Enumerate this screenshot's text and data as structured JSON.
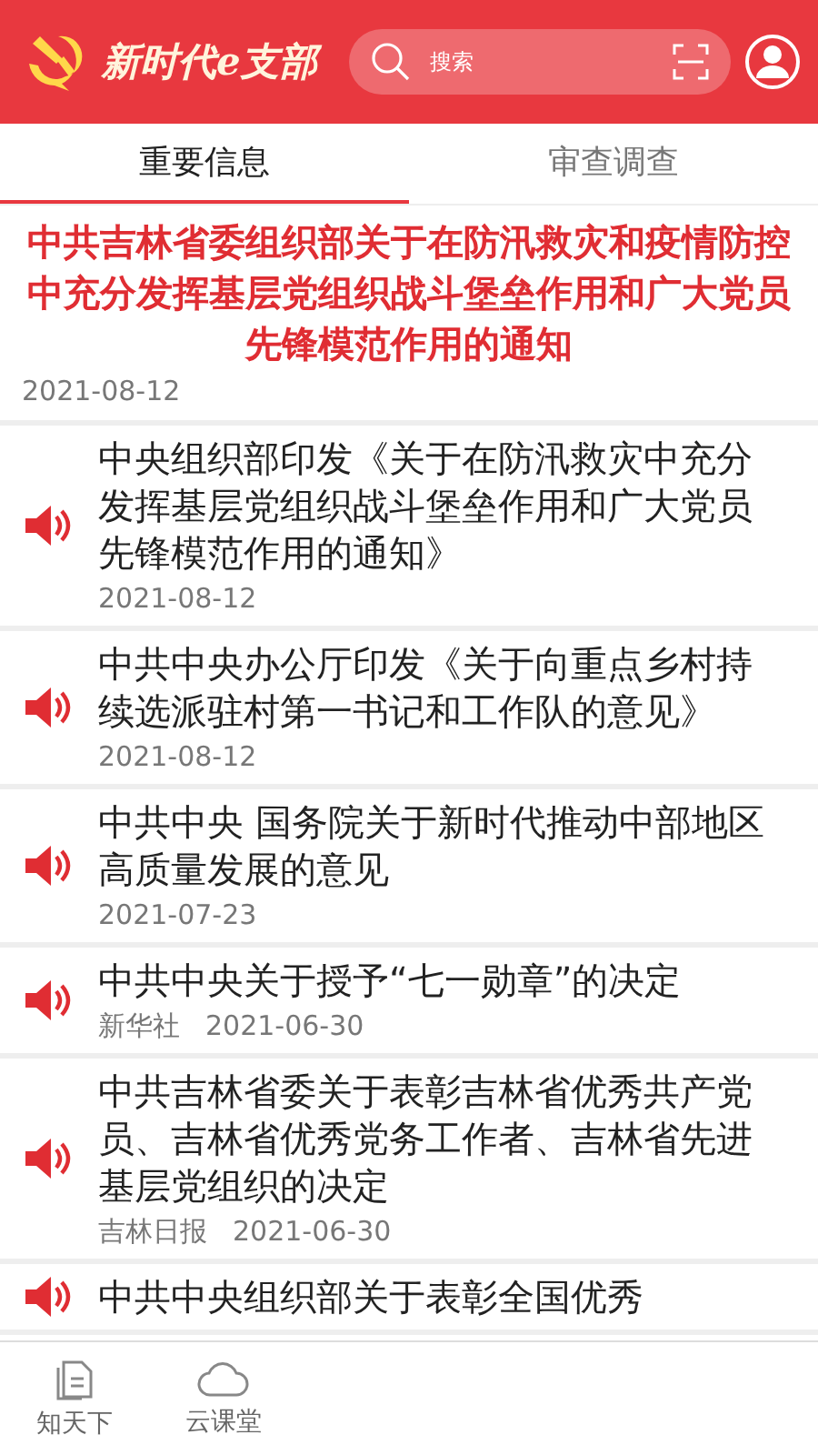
{
  "header": {
    "app_title": "新时代e支部",
    "search": {
      "placeholder": "搜索"
    }
  },
  "tabs": [
    {
      "label": "重要信息",
      "selected": true
    },
    {
      "label": "审查调查",
      "selected": false
    }
  ],
  "featured": {
    "title": "中共吉林省委组织部关于在防汛救灾和疫情防控中充分发挥基层党组织战斗堡垒作用和广大党员先锋模范作用的通知",
    "date": "2021-08-12"
  },
  "news": [
    {
      "title": "中央组织部印发《关于在防汛救灾中充分发挥基层党组织战斗堡垒作用和广大党员先锋模范作用的通知》",
      "date": "2021-08-12"
    },
    {
      "title": "中共中央办公厅印发《关于向重点乡村持续选派驻村第一书记和工作队的意见》",
      "date": "2021-08-12"
    },
    {
      "title": "中共中央 国务院关于新时代推动中部地区高质量发展的意见",
      "date": "2021-07-23"
    },
    {
      "title": "中共中央关于授予“七一勋章”的决定",
      "source": "新华社",
      "date": "2021-06-30"
    },
    {
      "title": "中共吉林省委关于表彰吉林省优秀共产党员、吉林省优秀党务工作者、吉林省先进基层党组织的决定",
      "source": "吉林日报",
      "date": "2021-06-30"
    },
    {
      "title": "中共中央组织部关于表彰全国优秀"
    }
  ],
  "bottom_nav": [
    {
      "label": "知天下",
      "kind": "document"
    },
    {
      "label": "云课堂",
      "kind": "cloud"
    }
  ]
}
